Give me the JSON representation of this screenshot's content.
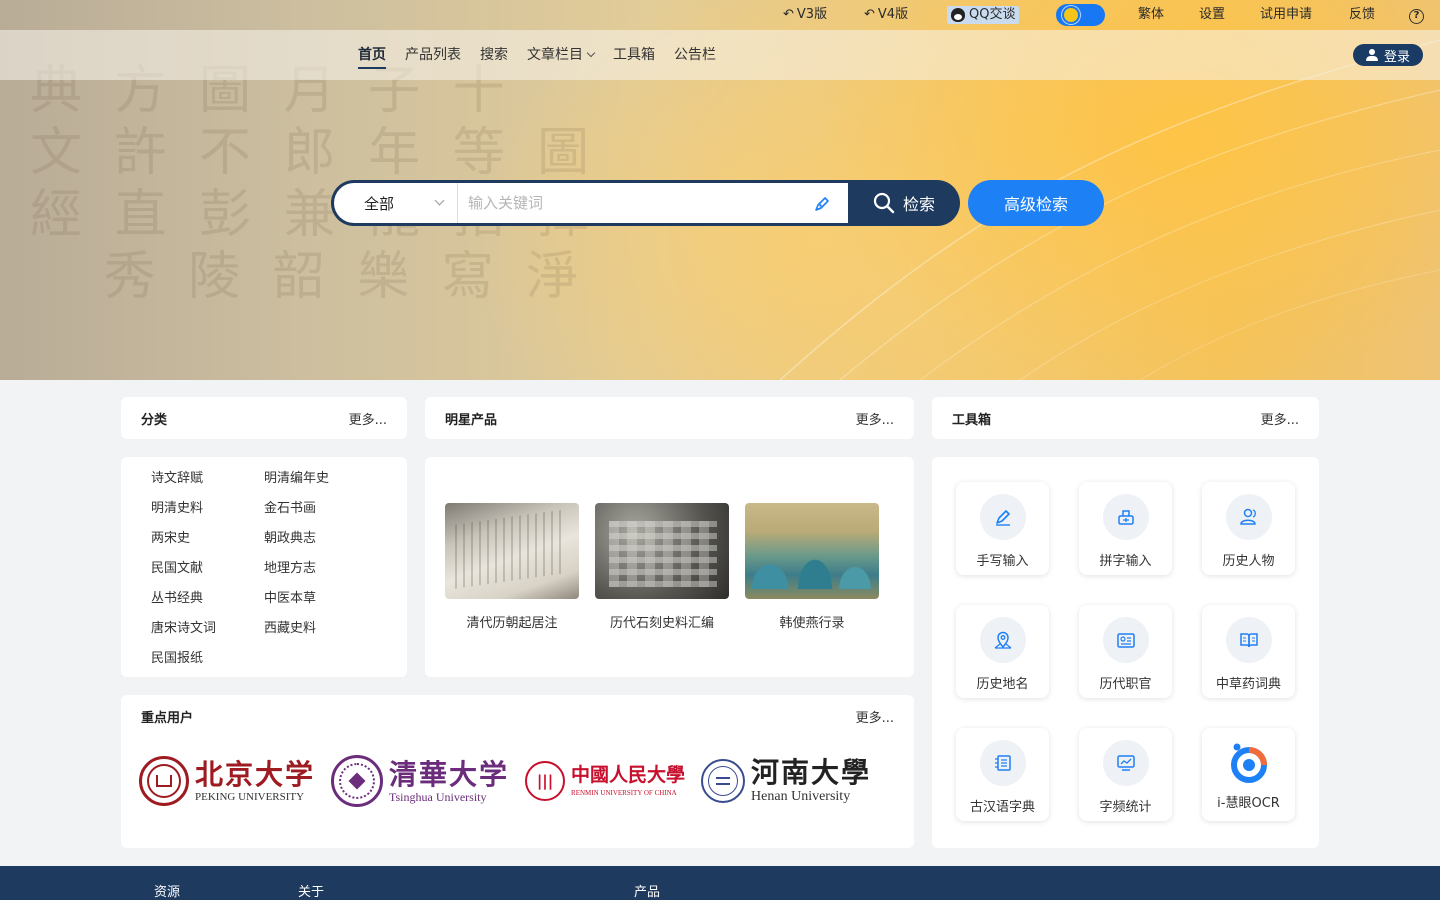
{
  "topbar": {
    "v3": "V3版",
    "v4": "V4版",
    "qq": "QQ交谈",
    "traditional": "繁体",
    "settings": "设置",
    "trial": "试用申请",
    "feedback": "反馈",
    "help": "?"
  },
  "nav": {
    "tabs": [
      {
        "label": "首页",
        "active": true
      },
      {
        "label": "产品列表"
      },
      {
        "label": "搜索"
      },
      {
        "label": "文章栏目"
      },
      {
        "label": "工具箱"
      },
      {
        "label": "公告栏"
      }
    ],
    "login": "登录"
  },
  "search": {
    "scope": "全部",
    "placeholder": "输入关键词",
    "button": "检索",
    "advanced": "高级检索"
  },
  "categories": {
    "title": "分类",
    "more": "更多...",
    "items": [
      "诗文辞赋",
      "明清编年史",
      "明清史料",
      "金石书画",
      "两宋史",
      "朝政典志",
      "民国文献",
      "地理方志",
      "丛书经典",
      "中医本草",
      "唐宋诗文词",
      "西藏史料",
      "民国报纸"
    ]
  },
  "star_products": {
    "title": "明星产品",
    "more": "更多...",
    "items": [
      "清代历朝起居注",
      "历代石刻史料汇编",
      "韩使燕行录"
    ]
  },
  "toolbox": {
    "title": "工具箱",
    "more": "更多...",
    "items": [
      "手写输入",
      "拼字输入",
      "历史人物",
      "历史地名",
      "历代职官",
      "中草药词典",
      "古汉语字典",
      "字频统计",
      "i-慧眼OCR"
    ]
  },
  "key_users": {
    "title": "重点用户",
    "more": "更多...",
    "logos": [
      {
        "cn": "北京大学",
        "en": "PEKING UNIVERSITY"
      },
      {
        "cn": "清華大学",
        "en": "Tsinghua University"
      },
      {
        "cn": "中國人民大學",
        "en": "RENMIN UNIVERSITY OF CHINA"
      },
      {
        "cn": "河南大學",
        "en": "Henan University"
      }
    ]
  },
  "footer": {
    "resources": "资源",
    "about": "关于",
    "products": "产品"
  },
  "colors": {
    "navy": "#1e3a5f",
    "accent_blue": "#1e80f5",
    "pku_red": "#9e1b21",
    "tsinghua_purple": "#6b2d7b",
    "ruc_red": "#c8102e",
    "henan_blue": "#3a4c8f"
  }
}
